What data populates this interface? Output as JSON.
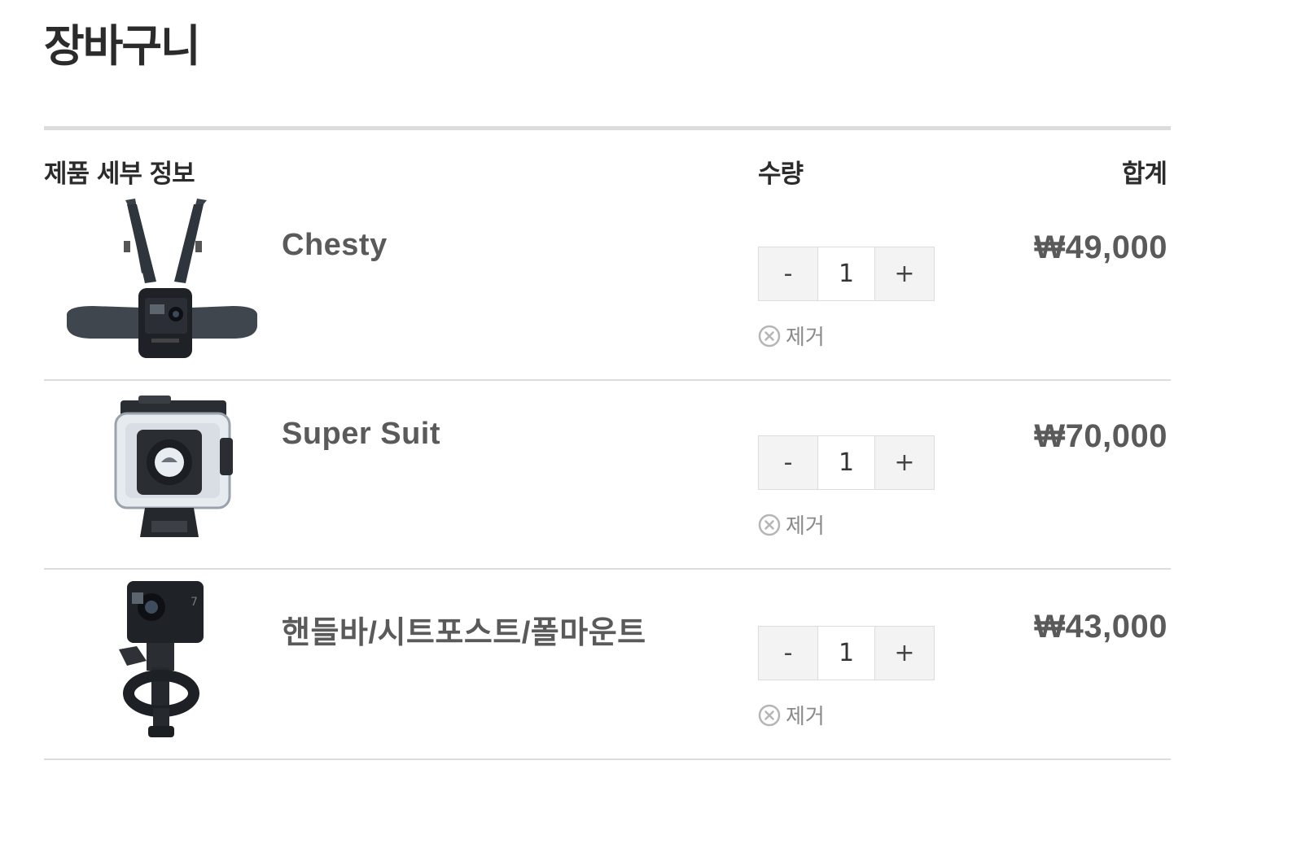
{
  "page": {
    "title": "장바구니"
  },
  "table": {
    "headers": {
      "product": "제품 세부 정보",
      "quantity": "수량",
      "total": "합계"
    }
  },
  "items": [
    {
      "name": "Chesty",
      "quantity": "1",
      "price": "₩49,000",
      "remove_label": "제거",
      "image": "chest-harness-mount-image"
    },
    {
      "name": "Super Suit",
      "quantity": "1",
      "price": "₩70,000",
      "remove_label": "제거",
      "image": "waterproof-housing-image"
    },
    {
      "name": "핸들바/시트포스트/폴마운트",
      "quantity": "1",
      "price": "₩43,000",
      "remove_label": "제거",
      "image": "handlebar-mount-camera-image"
    }
  ],
  "controls": {
    "minus": "-",
    "plus": "+"
  },
  "icons": {
    "remove": "remove-circle-x-icon"
  },
  "colors": {
    "text": "#2b2b2b",
    "muted": "#8a8a8a",
    "divider": "#dcdcdc",
    "stepper_bg": "#f3f3f3"
  }
}
